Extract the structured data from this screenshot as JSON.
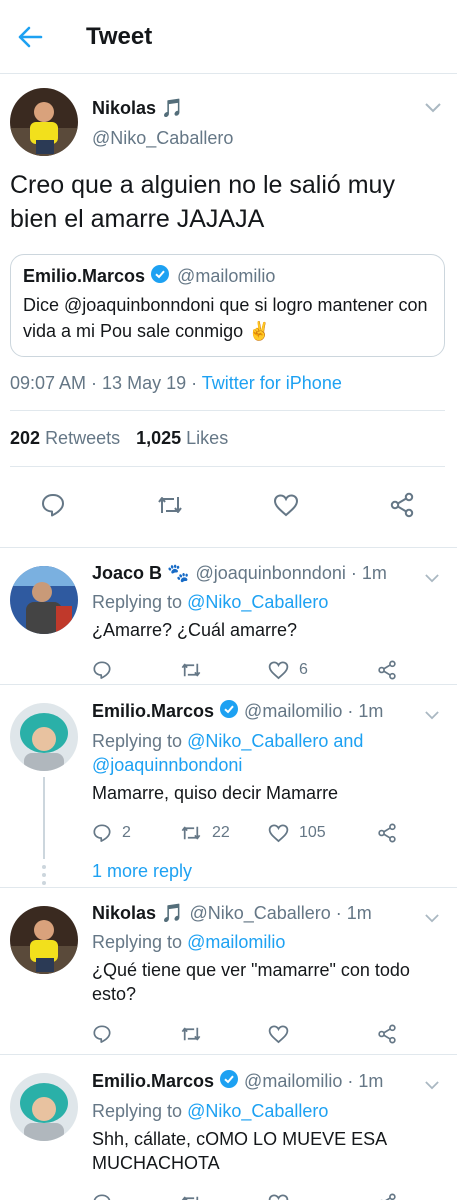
{
  "header": {
    "title": "Tweet"
  },
  "main_tweet": {
    "name": "Nikolas 🎵",
    "handle": "@Niko_Caballero",
    "text": "Creo que a alguien no le salió muy bien el amarre JAJAJA",
    "quote": {
      "name": "Emilio.Marcos",
      "handle": "@mailomilio",
      "text": "Dice @joaquinbonndoni que si logro mantener con vida a mi Pou sale conmigo ✌"
    },
    "time": "09:07 AM · 13 May 19 · ",
    "source": "Twitter for iPhone",
    "retweets": "202",
    "retweets_label": "Retweets",
    "likes": "1,025",
    "likes_label": "Likes"
  },
  "replies": [
    {
      "name": "Joaco B 🐾",
      "handle": "@joaquinbonndoni · 1m",
      "replying_prefix": "Replying to ",
      "replying_to": "@Niko_Caballero",
      "text": "¿Amarre? ¿Cuál amarre?",
      "replies": "",
      "retweets": "",
      "likes": "6"
    },
    {
      "name": "Emilio.Marcos",
      "handle": "@mailomilio · 1m",
      "replying_prefix": "Replying to ",
      "replying_to": "@Niko_Caballero and @joaquinnbondoni",
      "text": "Mamarre, quiso decir Mamarre",
      "replies": "2",
      "retweets": "22",
      "likes": "105",
      "more_reply": "1 more reply"
    },
    {
      "name": "Nikolas 🎵",
      "handle": "@Niko_Caballero · 1m",
      "replying_prefix": "Replying to ",
      "replying_to": "@mailomilio",
      "text": "¿Qué tiene que ver \"mamarre\" con todo esto?",
      "replies": "",
      "retweets": "",
      "likes": ""
    },
    {
      "name": "Emilio.Marcos",
      "handle": "@mailomilio · 1m",
      "replying_prefix": "Replying to ",
      "replying_to": "@Niko_Caballero",
      "text": "Shh, cállate, cOMO LO MUEVE ESA MUCHACHOTA",
      "replies": "",
      "retweets": "",
      "likes": ""
    }
  ],
  "colors": {
    "accent": "#1da1f2",
    "muted": "#657786",
    "verified": "#1da1f2"
  }
}
